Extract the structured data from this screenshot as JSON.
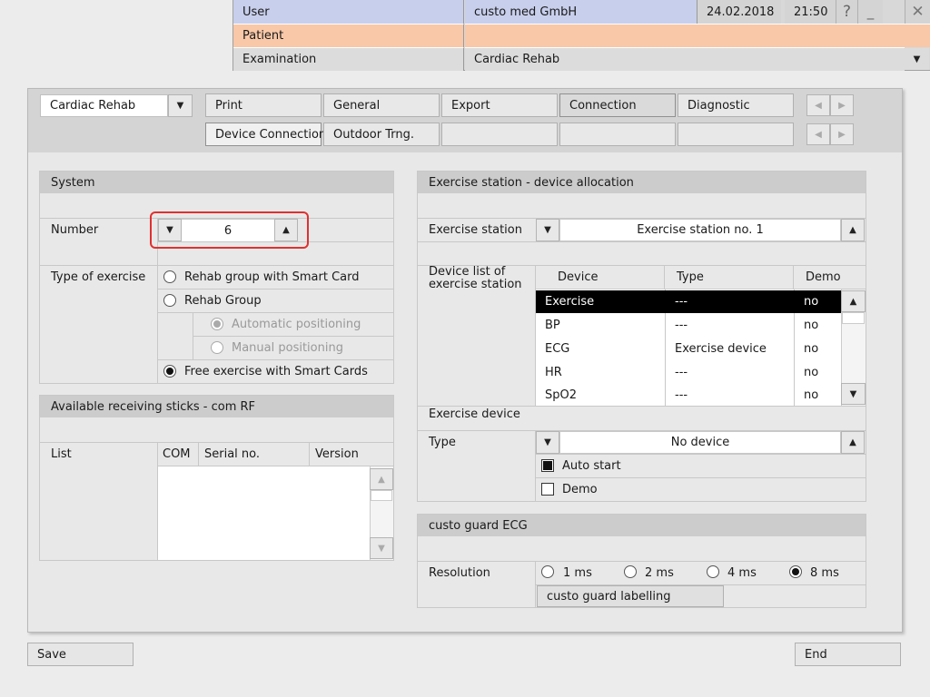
{
  "topbar": {
    "user_label": "User",
    "user_value": "custo med GmbH",
    "date": "24.02.2018",
    "time": "21:50",
    "help": "?",
    "minimize": "_",
    "close": "✕",
    "patient_label": "Patient",
    "examination_label": "Examination",
    "examination_value": "Cardiac Rehab"
  },
  "module_select": "Cardiac Rehab",
  "tabs_row1": [
    "Print",
    "General",
    "Export",
    "Connection",
    "Diagnostic"
  ],
  "tabs_row2": [
    "Device Connection",
    "Outdoor Trng."
  ],
  "system": {
    "title": "System",
    "number_label": "Number",
    "number_value": "6",
    "type_label": "Type of exercise",
    "opt1": "Rehab group with Smart Card",
    "opt2": "Rehab Group",
    "opt2a": "Automatic positioning",
    "opt2b": "Manual positioning",
    "opt3": "Free exercise with Smart Cards"
  },
  "sticks": {
    "title": "Available receiving sticks - com RF",
    "list_label": "List",
    "col_com": "COM",
    "col_serial": "Serial no.",
    "col_version": "Version"
  },
  "allocation": {
    "title": "Exercise station - device allocation",
    "station_label": "Exercise station",
    "station_value": "Exercise station no. 1",
    "device_list_label": "Device list of exercise station",
    "col_device": "Device",
    "col_type": "Type",
    "col_demo": "Demo",
    "rows": [
      {
        "device": "Exercise",
        "type": "---",
        "demo": "no"
      },
      {
        "device": "BP",
        "type": "---",
        "demo": "no"
      },
      {
        "device": "ECG",
        "type": "Exercise device",
        "demo": "no"
      },
      {
        "device": "HR",
        "type": "---",
        "demo": "no"
      },
      {
        "device": "SpO2",
        "type": "---",
        "demo": "no"
      }
    ],
    "exercise_device_label": "Exercise device",
    "type_label": "Type",
    "type_value": "No device",
    "auto_start": "Auto start",
    "demo": "Demo"
  },
  "guard": {
    "title": "custo guard ECG",
    "resolution_label": "Resolution",
    "r1": "1 ms",
    "r2": "2 ms",
    "r3": "4 ms",
    "r4": "8 ms",
    "labelling_button": "custo guard labelling"
  },
  "footer": {
    "save": "Save",
    "end": "End"
  },
  "colors": {
    "user_row": "#c8cfec",
    "patient_row": "#f8c8a8",
    "header_gray": "#cccccc",
    "highlight": "#e03030"
  }
}
